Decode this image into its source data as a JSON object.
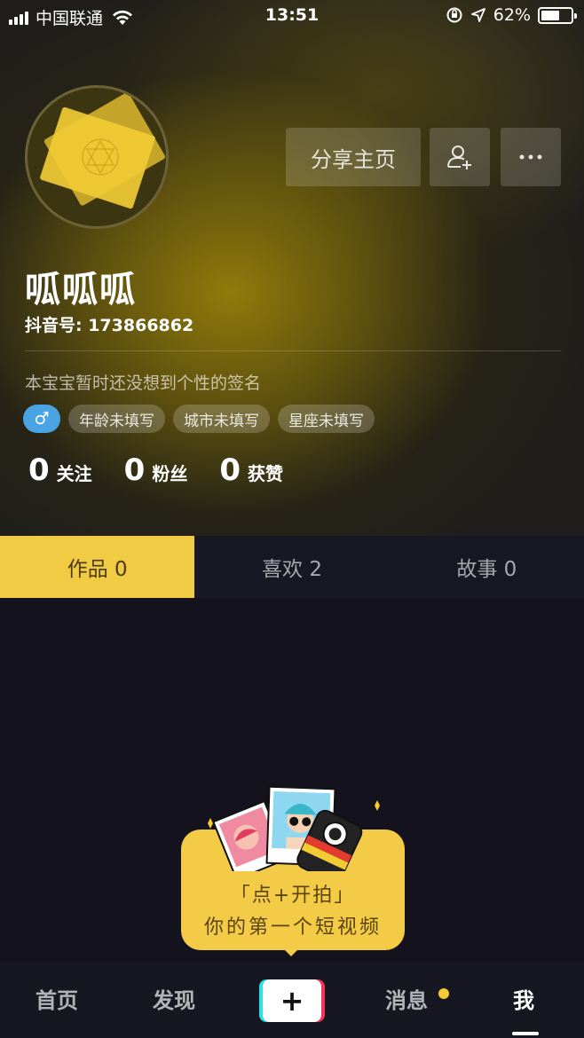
{
  "status_bar": {
    "carrier": "中国联通",
    "time": "13:51",
    "battery": "62%",
    "battery_level": 0.62
  },
  "profile": {
    "share_label": "分享主页",
    "name": "呱呱呱",
    "douyin_id": "抖音号: 173866862",
    "signature": "本宝宝暂时还没想到个性的签名",
    "gender_symbol": "♂",
    "tags": [
      "年龄未填写",
      "城市未填写",
      "星座未填写"
    ],
    "stats": [
      {
        "num": "0",
        "label": "关注"
      },
      {
        "num": "0",
        "label": "粉丝"
      },
      {
        "num": "0",
        "label": "获赞"
      }
    ]
  },
  "tabs": [
    {
      "label": "作品 0",
      "active": true
    },
    {
      "label": "喜欢 2",
      "active": false
    },
    {
      "label": "故事 0",
      "active": false
    }
  ],
  "promo": {
    "line1": "「点+开拍」",
    "line2": "你的第一个短视频"
  },
  "bottom_nav": {
    "home": "首页",
    "discover": "发现",
    "plus": "+",
    "messages": "消息",
    "me": "我"
  },
  "colors": {
    "accent_yellow": "#f2cb44",
    "gender_blue": "#4aa3e3",
    "plus_cyan": "#2ee0e6",
    "plus_red": "#f1365a"
  }
}
